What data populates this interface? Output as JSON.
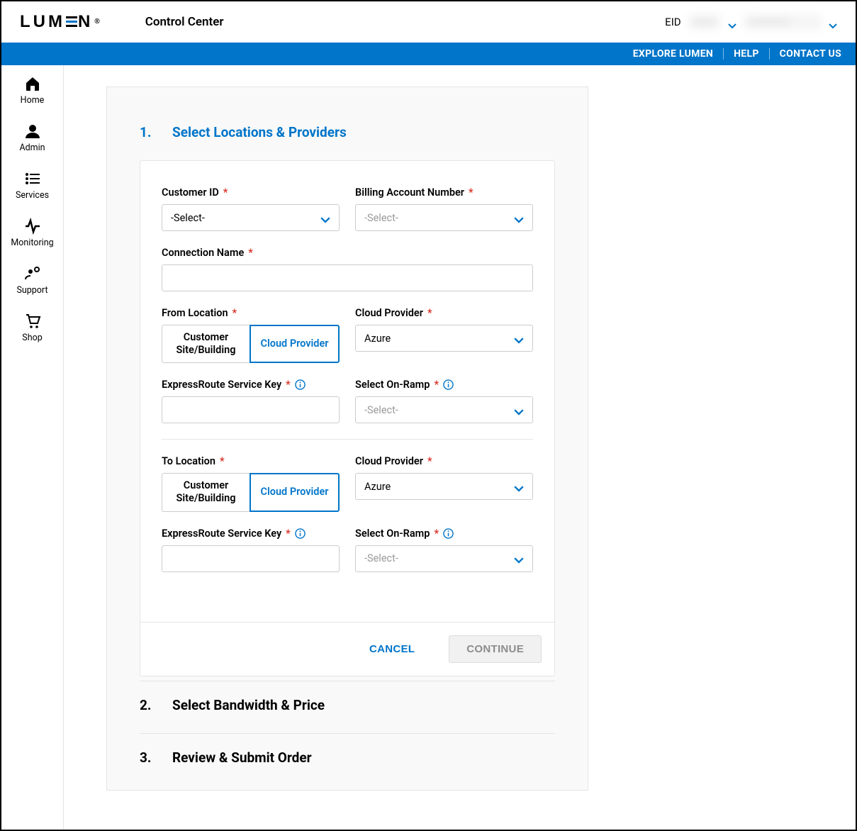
{
  "header": {
    "app_title": "Control Center",
    "eid_label": "EID",
    "eid_value_hidden": "••••••",
    "account_value_hidden": "•••••••••••"
  },
  "bluebar": {
    "explore": "EXPLORE LUMEN",
    "help": "HELP",
    "contact": "CONTACT US"
  },
  "sidebar": {
    "items": [
      {
        "label": "Home"
      },
      {
        "label": "Admin"
      },
      {
        "label": "Services"
      },
      {
        "label": "Monitoring"
      },
      {
        "label": "Support"
      },
      {
        "label": "Shop"
      }
    ]
  },
  "steps": {
    "s1": {
      "num": "1.",
      "title": "Select Locations & Providers"
    },
    "s2": {
      "num": "2.",
      "title": "Select Bandwidth & Price"
    },
    "s3": {
      "num": "3.",
      "title": "Review & Submit Order"
    }
  },
  "form": {
    "customer_id": {
      "label": "Customer ID",
      "value": "-Select-"
    },
    "billing": {
      "label": "Billing Account Number",
      "value": "-Select-"
    },
    "conn_name": {
      "label": "Connection Name",
      "value": ""
    },
    "from_loc": {
      "label": "From Location",
      "opt_site": "Customer Site/Building",
      "opt_cloud": "Cloud Provider"
    },
    "cloud_provider_from": {
      "label": "Cloud Provider",
      "value": "Azure"
    },
    "er_key_from": {
      "label": "ExpressRoute Service Key",
      "value": ""
    },
    "onramp_from": {
      "label": "Select On-Ramp",
      "value": "-Select-"
    },
    "to_loc": {
      "label": "To Location",
      "opt_site": "Customer Site/Building",
      "opt_cloud": "Cloud Provider"
    },
    "cloud_provider_to": {
      "label": "Cloud Provider",
      "value": "Azure"
    },
    "er_key_to": {
      "label": "ExpressRoute Service Key",
      "value": ""
    },
    "onramp_to": {
      "label": "Select On-Ramp",
      "value": "-Select-"
    }
  },
  "buttons": {
    "cancel": "CANCEL",
    "continue": "CONTINUE"
  }
}
